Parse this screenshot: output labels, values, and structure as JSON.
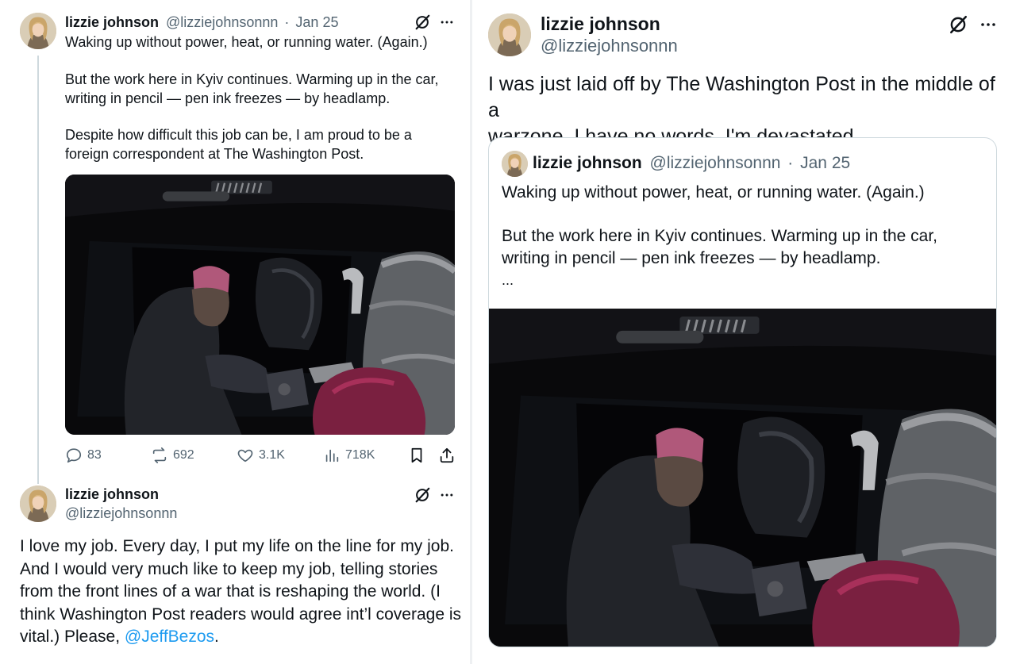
{
  "left_top_tweet": {
    "name": "lizzie johnson",
    "handle": "@lizziejohnsonnn",
    "separator": "·",
    "date": "Jan 25",
    "para1": "Waking up without power, heat, or running water. (Again.)",
    "para2": "But the work here in Kyiv continues. Warming up in the car,\nwriting in pencil — pen ink freezes — by headlamp.",
    "para3": "Despite how difficult this job can be, I am proud to be a\nforeign correspondent at The Washington Post.",
    "stats": {
      "replies": "83",
      "reposts": "692",
      "likes": "3.1K",
      "views": "718K"
    }
  },
  "left_reply_tweet": {
    "name": "lizzie johnson",
    "handle": "@lizziejohnsonnn",
    "text": "I love my job. Every day, I put my life on the line for my job.\nAnd I would very much like to keep my job, telling stories\nfrom the front lines of a war that is reshaping the world. (I\nthink Washington Post readers would agree int’l coverage is\nvital.) Please, ",
    "mention": "@JeffBezos",
    "trailing": "."
  },
  "right_tweet": {
    "name": "lizzie johnson",
    "handle": "@lizziejohnsonnn",
    "text": "I was just laid off by The Washington Post in the middle of a\nwarzone. I have no words. I'm devastated.",
    "quote": {
      "name": "lizzie johnson",
      "handle": "@lizziejohnsonnn",
      "separator": "·",
      "date": "Jan 25",
      "para1": "Waking up without power, heat, or running water. (Again.)",
      "para2": "But the work here in Kyiv continues. Warming up in the car,\nwriting in pencil — pen ink freezes — by headlamp.",
      "ellipsis": "..."
    }
  },
  "icons": {
    "grok": "grok-slash-icon",
    "more": "more-dots-icon",
    "reply": "reply-bubble-icon",
    "repost": "repost-arrows-icon",
    "like": "heart-icon",
    "views": "views-chart-icon",
    "bookmark": "bookmark-icon",
    "share": "share-upload-icon"
  },
  "colors": {
    "link": "#1d9bf0",
    "text": "#0f1419",
    "muted": "#536471",
    "border": "#cfd9de"
  }
}
